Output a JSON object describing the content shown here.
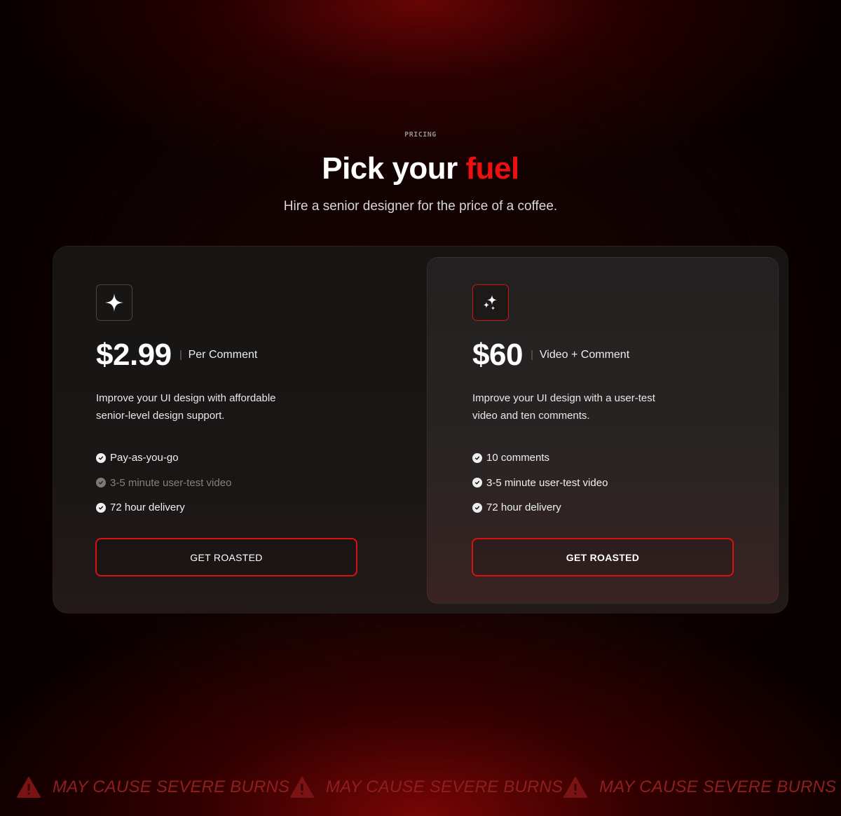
{
  "header": {
    "eyebrow": "PRICING",
    "title_main": "Pick your ",
    "title_accent": "fuel",
    "subtitle": "Hire a senior designer for the price of a coffee."
  },
  "plans": [
    {
      "icon": "sparkle-icon",
      "price": "$2.99",
      "unit": "Per Comment",
      "description": "Improve your UI design with affordable senior-level design support.",
      "features": [
        {
          "label": "Pay-as-you-go",
          "included": true
        },
        {
          "label": "3-5 minute user-test video",
          "included": false
        },
        {
          "label": "72 hour delivery",
          "included": true
        }
      ],
      "cta": "GET ROASTED"
    },
    {
      "icon": "sparkles-icon",
      "price": "$60",
      "unit": "Video + Comment",
      "description": "Improve your UI design with a user-test video and ten comments.",
      "features": [
        {
          "label": "10 comments",
          "included": true
        },
        {
          "label": "3-5 minute user-test video",
          "included": true
        },
        {
          "label": "72 hour delivery",
          "included": true
        }
      ],
      "cta": "GET ROASTED"
    }
  ],
  "banner": {
    "icon": "warning-icon",
    "text": "MAY CAUSE SEVERE BURNS"
  },
  "colors": {
    "accent": "#ec1010",
    "banner_text": "#8f1f1f"
  }
}
